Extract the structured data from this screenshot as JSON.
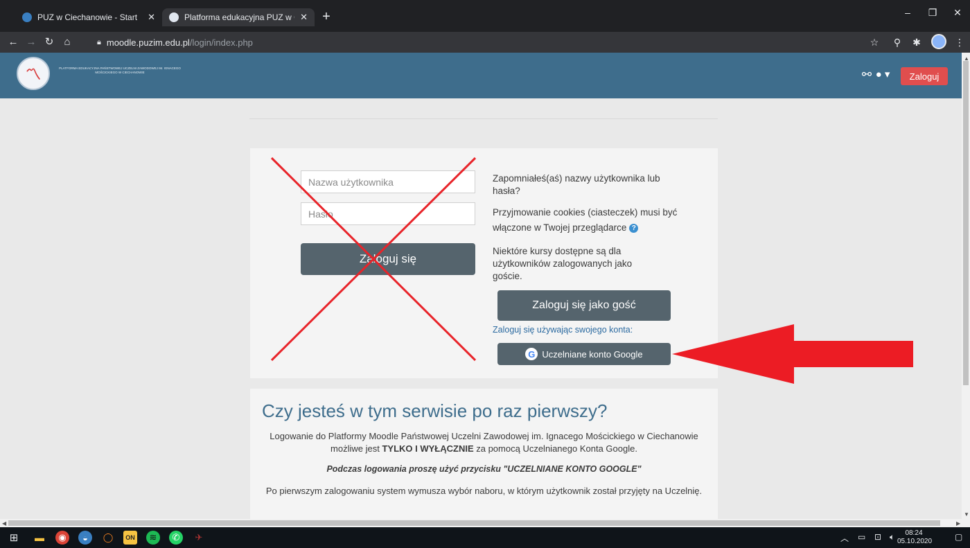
{
  "browser": {
    "tabs": [
      {
        "title": "PUZ w Ciechanowie - Start",
        "favicon_color": "#3a7fc1",
        "active": false
      },
      {
        "title": "Platforma edukacyjna PUZ w Cie",
        "favicon_color": "#e0e6ef",
        "active": true
      }
    ],
    "url_host": "moodle.puzim.edu.pl",
    "url_path": "/login/index.php"
  },
  "header": {
    "logo_text": "PLATFORMA EDUKACYJNA PAŃSTWOWEJ UCZELNI ZAWODOWEJ IM. IGNACEGO MOŚCICKIEGO W CIECHANOWIE",
    "login_button": "Zaloguj",
    "brand_color": "#3e6d8c",
    "accent_color": "#e04e4e"
  },
  "login": {
    "username_placeholder": "Nazwa użytkownika",
    "password_placeholder": "Hasło",
    "login_button": "Zaloguj się",
    "forgot_text": "Zapomniałeś(aś) nazwy użytkownika lub hasła?",
    "cookies_text": "Przyjmowanie cookies (ciasteczek) musi być włączone w Twojej przeglądarce",
    "guest_info": "Niektóre kursy dostępne są dla użytkowników zalogowanych jako goście.",
    "guest_button": "Zaloguj się jako gość",
    "oauth_label": "Zaloguj się używając swojego konta:",
    "google_button": "Uczelniane konto Google"
  },
  "info": {
    "title": "Czy jesteś w tym serwisie po raz pierwszy?",
    "p1_before": "Logowanie do Platformy Moodle Państwowej Uczelni Zawodowej im. Ignacego Mościckiego w Ciechanowie możliwe jest ",
    "p1_bold": "TYLKO I WYŁĄCZNIE",
    "p1_after": " za pomocą Uczelnianego Konta Google.",
    "p2": "Podczas logowania proszę użyć przycisku \"UCZELNIANE KONTO GOOGLE\"",
    "p3": "Po pierwszym zalogowaniu system wymusza wybór naboru, w którym użytkownik został przyjęty na Uczelnię."
  },
  "taskbar": {
    "time": "08:24",
    "date": "05.10.2020"
  },
  "annotations": {
    "cross_color": "#e8242a",
    "arrow_color": "#ec1c24"
  }
}
